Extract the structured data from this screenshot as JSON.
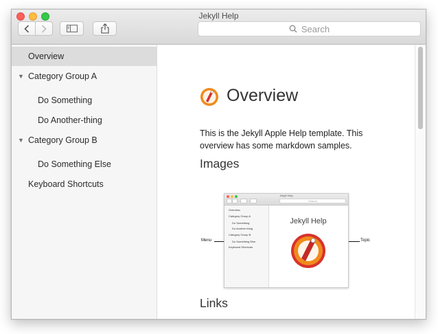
{
  "window": {
    "title": "Jekyll Help"
  },
  "toolbar": {
    "back_icon": "chevron-left-icon",
    "forward_icon": "chevron-right-icon",
    "sidebar_icon": "sidebar-toggle-icon",
    "share_icon": "share-icon",
    "search_placeholder": "Search"
  },
  "sidebar": {
    "items": [
      {
        "label": "Overview",
        "level": 0,
        "selected": true,
        "expandable": false
      },
      {
        "label": "Category Group A",
        "level": 0,
        "selected": false,
        "expandable": true,
        "expanded": true
      },
      {
        "label": "Do Something",
        "level": 1,
        "selected": false,
        "expandable": false
      },
      {
        "label": "Do Another-thing",
        "level": 1,
        "selected": false,
        "expandable": false
      },
      {
        "label": "Category Group B",
        "level": 0,
        "selected": false,
        "expandable": true,
        "expanded": true
      },
      {
        "label": "Do Something Else",
        "level": 1,
        "selected": false,
        "expandable": false
      },
      {
        "label": "Keyboard Shortcuts",
        "level": 0,
        "selected": false,
        "expandable": false
      }
    ]
  },
  "content": {
    "title": "Overview",
    "intro": "This is the Jekyll Apple Help template. This overview has some markdown samples.",
    "sections": [
      {
        "heading": "Images"
      },
      {
        "heading": "Links"
      }
    ],
    "figure": {
      "window_title": "Jekyll Help",
      "search_placeholder": "Search",
      "sidebar_items": [
        "Overview",
        "Category Group A",
        "Do Something",
        "Do Another-thing",
        "Category Group B",
        "Do Something Else",
        "Keyboard Shortcuts"
      ],
      "main_title": "Jekyll Help",
      "callout_left": "Menu",
      "callout_right": "Topic"
    }
  },
  "colors": {
    "selected_row": "#dcdcdc",
    "close": "#fc605c",
    "minimize": "#fdbc40",
    "maximize": "#34c84a",
    "icon_orange": "#f08a1c",
    "icon_red": "#d8322c"
  }
}
